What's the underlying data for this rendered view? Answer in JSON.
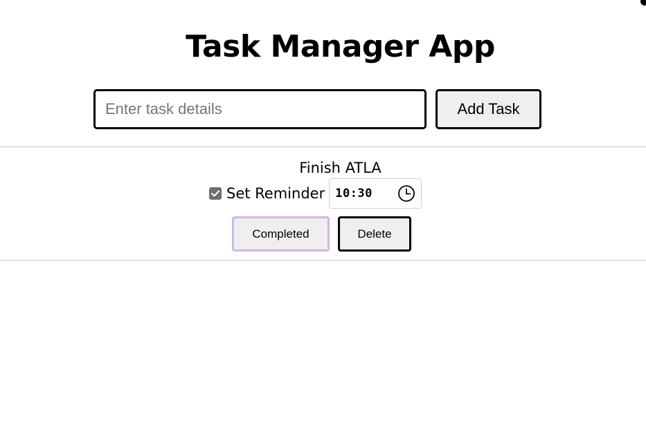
{
  "header": {
    "title": "Task Manager App"
  },
  "task_form": {
    "input_value": "",
    "input_placeholder": "Enter task details",
    "add_button_label": "Add Task"
  },
  "tasks": [
    {
      "text": "Finish ATLA",
      "reminder_checked": true,
      "reminder_label": "Set Reminder",
      "reminder_time": "10:30",
      "completed_label": "Completed",
      "delete_label": "Delete",
      "completed_border_color": "#d3b5e5"
    }
  ],
  "icons": {
    "checkbox": "check-icon",
    "time_picker": "clock-icon"
  }
}
